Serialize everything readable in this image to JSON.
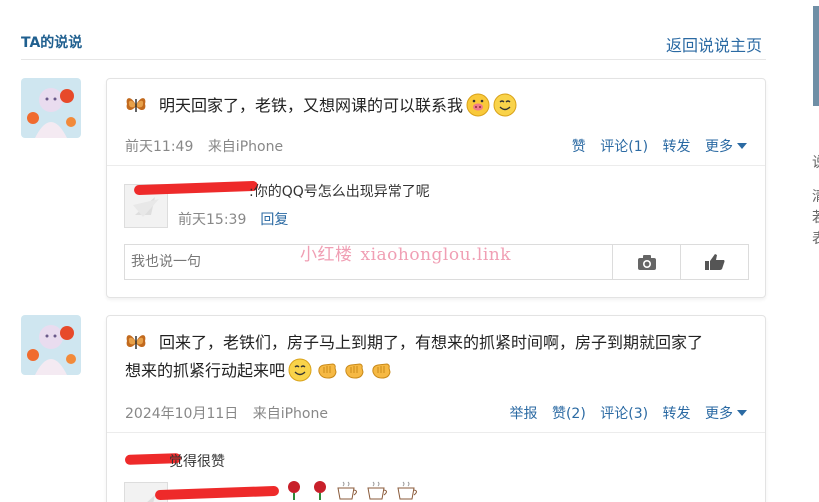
{
  "header": {
    "title": "TA的说说",
    "back_link": "返回说说主页"
  },
  "posts": [
    {
      "text": "明天回家了，老铁，又想网课的可以联系我",
      "time": "前天11:49",
      "source": "来自iPhone",
      "actions": [
        "赞",
        "评论(1)",
        "转发",
        "更多"
      ],
      "comment": {
        "text": ":你的QQ号怎么出现异常了呢",
        "time": "前天15:39",
        "reply": "回复"
      },
      "input_placeholder": "我也说一句"
    },
    {
      "text_line1": "回来了，老铁们，房子马上到期了，有想来的抓紧时间啊，房子到期就回家了",
      "text_line2": "想来的抓紧行动起来吧",
      "time": "2024年10月11日",
      "source": "来自iPhone",
      "actions": [
        "举报",
        "赞(2)",
        "评论(3)",
        "转发",
        "更多"
      ],
      "comment": {
        "text": "觉得很赞"
      }
    }
  ],
  "watermark": {
    "cn": "小红楼",
    "url": "xiaohonglou.link"
  },
  "right_edge_chars": [
    "说",
    "清",
    "若",
    "表"
  ],
  "icons": {
    "butterfly": "butterfly-icon",
    "camera": "camera-icon",
    "like": "thumb-icon",
    "more": "caret-down-icon"
  },
  "colors": {
    "link": "#2b6aa3",
    "title": "#1f5f8f",
    "redaction": "#ee2a2a",
    "watermark": "#f09fb4"
  }
}
